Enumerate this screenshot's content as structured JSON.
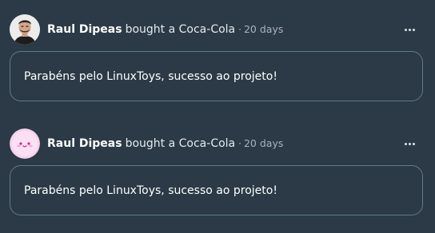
{
  "posts": [
    {
      "user": "Raul Dipeas",
      "action": "bought a Coca-Cola",
      "separator": "·",
      "time": "20 days",
      "message": "Parabéns pelo LinuxToys, sucesso ao projeto!",
      "avatar_icon": "user-photo-avatar"
    },
    {
      "user": "Raul Dipeas",
      "action": "bought a Coca-Cola",
      "separator": "·",
      "time": "20 days",
      "message": "Parabéns pelo LinuxToys, sucesso ao projeto!",
      "avatar_icon": "pink-smiley-avatar"
    }
  ],
  "colors": {
    "background": "#2b3a46",
    "bubble_border": "#607a89",
    "muted_text": "#a8b3bd",
    "pink_avatar": "#f7d2ee"
  },
  "icons": {
    "more": "more-horizontal-icon"
  }
}
